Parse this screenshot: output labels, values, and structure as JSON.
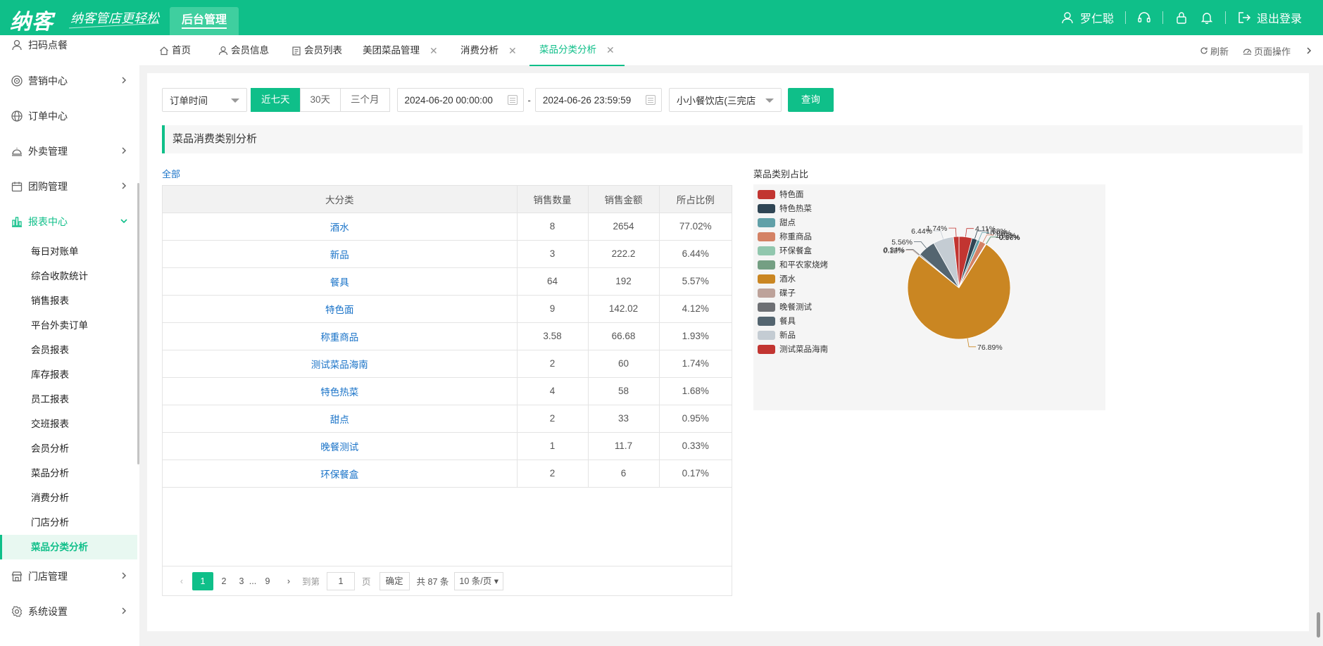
{
  "brand": {
    "logo": "纳客",
    "slogan": "纳客管店更轻松",
    "admin_tab": "后台管理"
  },
  "topbar": {
    "user_name": "罗仁聪",
    "logout": "退出登录"
  },
  "sidebar": {
    "items": [
      {
        "label": "扫码点餐"
      },
      {
        "label": "营销中心"
      },
      {
        "label": "订单中心"
      },
      {
        "label": "外卖管理"
      },
      {
        "label": "团购管理"
      },
      {
        "label": "报表中心"
      },
      {
        "label": "门店管理"
      },
      {
        "label": "系统设置"
      }
    ],
    "sub_items": [
      {
        "label": "每日对账单"
      },
      {
        "label": "综合收款统计"
      },
      {
        "label": "销售报表"
      },
      {
        "label": "平台外卖订单"
      },
      {
        "label": "会员报表"
      },
      {
        "label": "库存报表"
      },
      {
        "label": "员工报表"
      },
      {
        "label": "交班报表"
      },
      {
        "label": "会员分析"
      },
      {
        "label": "菜品分析"
      },
      {
        "label": "消费分析"
      },
      {
        "label": "门店分析"
      },
      {
        "label": "菜品分类分析"
      }
    ]
  },
  "tabs": [
    {
      "label": "首页"
    },
    {
      "label": "会员信息"
    },
    {
      "label": "会员列表"
    },
    {
      "label": "美团菜品管理"
    },
    {
      "label": "消费分析"
    },
    {
      "label": "菜品分类分析"
    }
  ],
  "tab_tools": {
    "refresh": "刷新",
    "page_ops": "页面操作"
  },
  "filters": {
    "time_type": "订单时间",
    "ranges": [
      "近七天",
      "30天",
      "三个月"
    ],
    "start": "2024-06-20 00:00:00",
    "dash": "-",
    "end": "2024-06-26 23:59:59",
    "store": "小小餐饮店(三完店",
    "query": "查询"
  },
  "section_title": "菜品消费类别分析",
  "all_link": "全部",
  "table": {
    "headers": [
      "大分类",
      "销售数量",
      "销售金额",
      "所占比例"
    ],
    "rows": [
      [
        "酒水",
        "8",
        "2654",
        "77.02%"
      ],
      [
        "新品",
        "3",
        "222.2",
        "6.44%"
      ],
      [
        "餐具",
        "64",
        "192",
        "5.57%"
      ],
      [
        "特色面",
        "9",
        "142.02",
        "4.12%"
      ],
      [
        "称重商品",
        "3.58",
        "66.68",
        "1.93%"
      ],
      [
        "测试菜品海南",
        "2",
        "60",
        "1.74%"
      ],
      [
        "特色热菜",
        "4",
        "58",
        "1.68%"
      ],
      [
        "甜点",
        "2",
        "33",
        "0.95%"
      ],
      [
        "晚餐测试",
        "1",
        "11.7",
        "0.33%"
      ],
      [
        "环保餐盒",
        "2",
        "6",
        "0.17%"
      ]
    ]
  },
  "pager": {
    "prev": "‹",
    "next": "›",
    "pages": [
      "1",
      "2",
      "3",
      "...",
      "9"
    ],
    "goto": "到第",
    "goto_value": "1",
    "page_unit": "页",
    "confirm": "确定",
    "total": "共 87 条",
    "size": "10 条/页"
  },
  "chart_data": {
    "type": "pie",
    "title": "菜品类别占比",
    "legend_position": "left",
    "slices": [
      {
        "name": "特色面",
        "value": 4.11,
        "label": "4.11%",
        "color": "#c23531"
      },
      {
        "name": "特色热菜",
        "value": 1.68,
        "label": "1.68%",
        "color": "#2f4554"
      },
      {
        "name": "甜点",
        "value": 0.96,
        "label": "0.96%",
        "color": "#61a0a8"
      },
      {
        "name": "称重商品",
        "value": 1.93,
        "label": "1.93%",
        "color": "#d48265"
      },
      {
        "name": "环保餐盒",
        "value": 0.17,
        "label": "0.17%",
        "color": "#91c7ae"
      },
      {
        "name": "和平农家烧烤",
        "value": 0.06,
        "label": "0.06%",
        "color": "#749f83"
      },
      {
        "name": "酒水",
        "value": 76.89,
        "label": "76.89%",
        "color": "#ca8622"
      },
      {
        "name": "碟子",
        "value": 0.12,
        "label": "0.12%",
        "color": "#bda29a"
      },
      {
        "name": "晚餐测试",
        "value": 0.34,
        "label": "0.34%",
        "color": "#6e7074"
      },
      {
        "name": "餐具",
        "value": 5.56,
        "label": "5.56%",
        "color": "#546570"
      },
      {
        "name": "新品",
        "value": 6.44,
        "label": "6.44%",
        "color": "#c4ccd3"
      },
      {
        "name": "测试菜品海南",
        "value": 1.74,
        "label": "1.74%",
        "color": "#c23531"
      }
    ]
  }
}
